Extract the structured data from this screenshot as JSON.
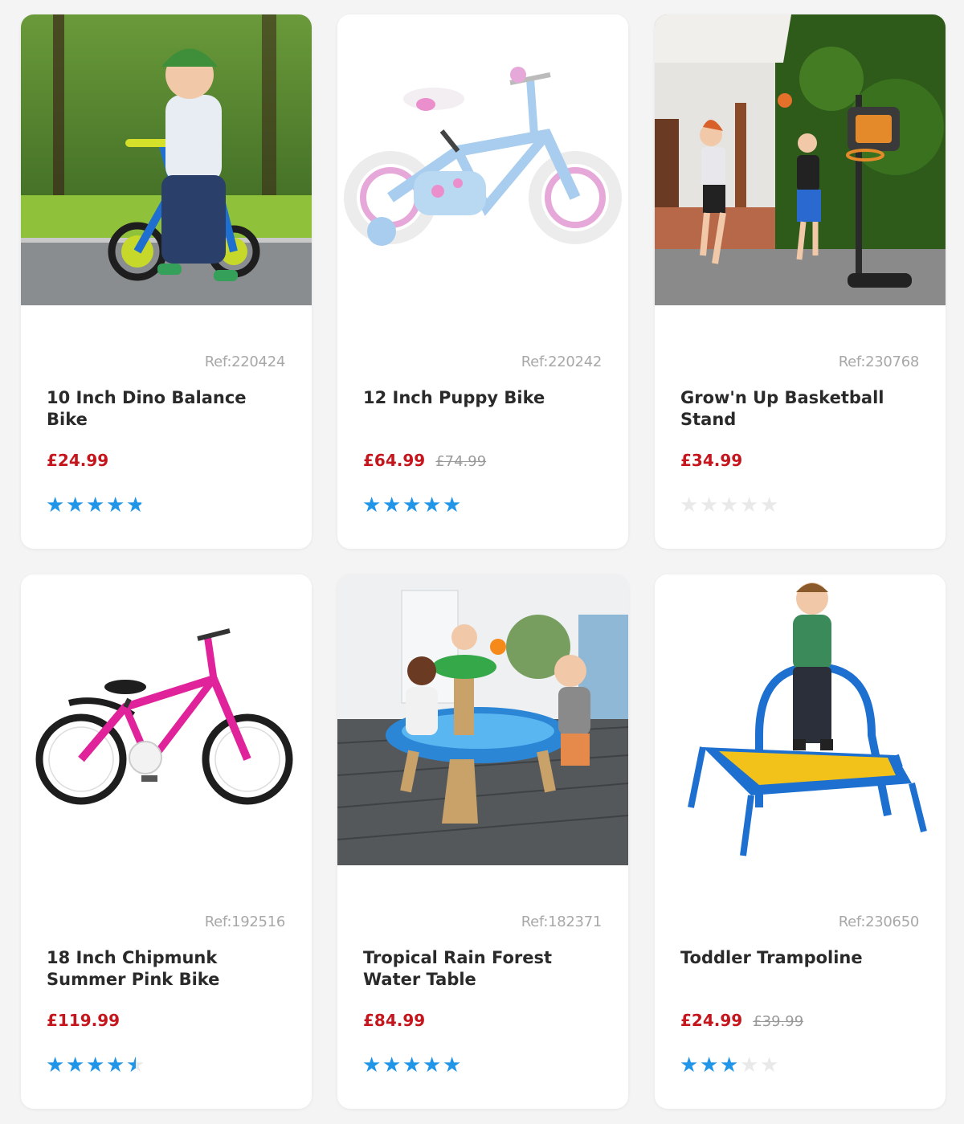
{
  "colors": {
    "price": "#c4161c",
    "star_filled": "#2196e8",
    "star_empty": "#e9e9e9",
    "ref": "#a8a8a8",
    "background": "#f4f4f4"
  },
  "products": [
    {
      "ref": "Ref:220424",
      "title": "10 Inch Dino Balance Bike",
      "price": "£24.99",
      "was_price": "",
      "rating": 4.8,
      "rating_max": 5,
      "image": "toddler-on-blue-balance-bike-photo"
    },
    {
      "ref": "Ref:220242",
      "title": "12 Inch Puppy Bike",
      "price": "£64.99",
      "was_price": "£74.99",
      "rating": 5,
      "rating_max": 5,
      "image": "pale-blue-kids-bike-with-stabilisers-photo"
    },
    {
      "ref": "Ref:230768",
      "title": "Grow'n Up Basketball Stand",
      "price": "£34.99",
      "was_price": "",
      "rating": 0,
      "rating_max": 5,
      "image": "children-playing-basketball-photo"
    },
    {
      "ref": "Ref:192516",
      "title": "18 Inch Chipmunk Summer Pink Bike",
      "price": "£119.99",
      "was_price": "",
      "rating": 4.5,
      "rating_max": 5,
      "image": "pink-kids-bike-photo"
    },
    {
      "ref": "Ref:182371",
      "title": "Tropical Rain Forest Water Table",
      "price": "£84.99",
      "was_price": "",
      "rating": 5,
      "rating_max": 5,
      "image": "toddlers-at-water-table-photo"
    },
    {
      "ref": "Ref:230650",
      "title": "Toddler Trampoline",
      "price": "£24.99",
      "was_price": "£39.99",
      "rating": 3,
      "rating_max": 5,
      "image": "boy-on-toddler-trampoline-photo"
    }
  ]
}
